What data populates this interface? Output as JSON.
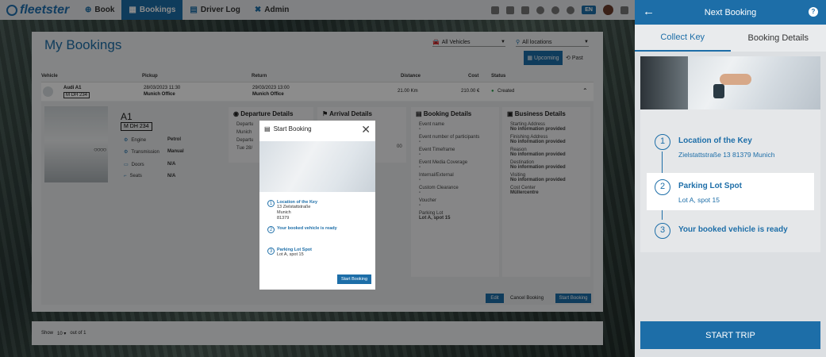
{
  "nav": {
    "logo": "fleetster",
    "items": [
      {
        "label": "Book",
        "icon": "plus-icon"
      },
      {
        "label": "Bookings",
        "icon": "calendar-icon"
      },
      {
        "label": "Driver Log",
        "icon": "log-icon"
      },
      {
        "label": "Admin",
        "icon": "tools-icon"
      }
    ],
    "lang": "EN"
  },
  "page": {
    "title": "My Bookings",
    "filter_vehicles": "All Vehicles",
    "filter_locations": "All locations",
    "btn_upcoming": "Upcoming",
    "btn_past": "Past"
  },
  "table": {
    "headers": [
      "Vehicle",
      "Pickup",
      "Return",
      "Distance",
      "Cost",
      "Status"
    ],
    "row": {
      "vehicle": "Audi A1",
      "plate": "M DH 234",
      "pickup_date": "28/03/2023 11:30",
      "pickup_loc": "Munich Office",
      "return_date": "29/03/2023 13:00",
      "return_loc": "Munich Office",
      "distance": "21.00 Km",
      "cost": "210.00 €",
      "status": "Created"
    }
  },
  "detail": {
    "model": "A1",
    "plate": "M DH 234",
    "specs": [
      {
        "label": "Engine",
        "value": "Petrol"
      },
      {
        "label": "Transmission",
        "value": "Manual"
      },
      {
        "label": "Doors",
        "value": "N/A"
      },
      {
        "label": "Seats",
        "value": "N/A"
      }
    ],
    "departure_title": "Departure Details",
    "departure_items": [
      "Departu",
      "Munich",
      "Departu",
      "Tue 28/"
    ],
    "arrival_title": "Arrival Details",
    "arrival_fragment": "00",
    "booking_title": "Booking Details",
    "booking_items": [
      {
        "label": "Event name",
        "value": "-"
      },
      {
        "label": "Event number of participants",
        "value": "-"
      },
      {
        "label": "Event Timeframe",
        "value": "-"
      },
      {
        "label": "Event Media Coverage",
        "value": "-"
      },
      {
        "label": "Internal/External",
        "value": "-"
      },
      {
        "label": "Custom Clearance",
        "value": "-"
      },
      {
        "label": "Voucher",
        "value": "-"
      },
      {
        "label": "Parking Lot",
        "value": "Lot A, spot 15"
      }
    ],
    "business_title": "Business Details",
    "business_items": [
      {
        "label": "Starting Address",
        "value": "No information provided"
      },
      {
        "label": "Finishing Address",
        "value": "No information provided"
      },
      {
        "label": "Reason",
        "value": "No information provided"
      },
      {
        "label": "Destination",
        "value": "No information provided"
      },
      {
        "label": "Visiting",
        "value": "No information provided"
      },
      {
        "label": "Cost Center",
        "value": "Müllercentre"
      }
    ],
    "btn_edit": "Edit",
    "btn_cancel": "Cancel Booking",
    "btn_start": "Start Booking"
  },
  "pager": {
    "show": "Show",
    "size": "10",
    "of": "out of 1"
  },
  "modal": {
    "title": "Start Booking",
    "step1_title": "Location of the Key",
    "step1_lines": [
      "13 Zielstattstraße",
      "Munich",
      "81379"
    ],
    "step2_title": "Your booked vehicle is ready",
    "step3_title": "Parking Lot Spot",
    "step3_desc": "Lot A, spot 15",
    "btn": "Start Booking"
  },
  "panel": {
    "title": "Next Booking",
    "tab1": "Collect Key",
    "tab2": "Booking Details",
    "step1_title": "Location of the Key",
    "step1_desc": "Zielstattstraße 13 81379 Munich",
    "step2_title": "Parking Lot Spot",
    "step2_desc": "Lot A, spot 15",
    "step3_title": "Your booked vehicle is ready",
    "btn": "START TRIP"
  },
  "colors": {
    "brand": "#1d6ea8"
  }
}
